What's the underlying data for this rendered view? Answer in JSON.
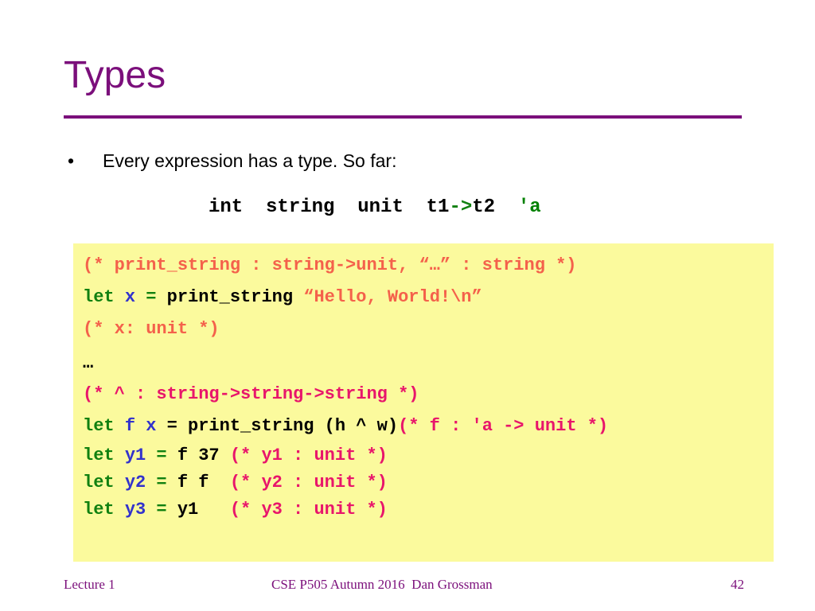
{
  "slide": {
    "title": "Types",
    "accent_color": "#7B0F7B",
    "bullet": {
      "marker": "•",
      "text": "Every expression has a type. So far:"
    },
    "typeline": {
      "segments": [
        {
          "text": "int  string  unit  t1",
          "color": "#000000"
        },
        {
          "text": "->",
          "color": "#108010"
        },
        {
          "text": "t2 ",
          "color": "#000000"
        },
        {
          "text": " ′a",
          "color": "#008000"
        }
      ]
    },
    "codebox": {
      "background": "#FBFA9D",
      "lines": [
        {
          "id": "comment-print-string",
          "segments": [
            {
              "text": "(* print_string : string->unit, “…” : string *)",
              "color": "#F4614B"
            }
          ]
        },
        {
          "id": "let-x",
          "segments": [
            {
              "text": "let",
              "color": "#108010"
            },
            {
              "text": " ",
              "color": "#000000"
            },
            {
              "text": "x",
              "color": "#3333CC"
            },
            {
              "text": " ",
              "color": "#000000"
            },
            {
              "text": "=",
              "color": "#108010"
            },
            {
              "text": " print_string ",
              "color": "#000000"
            },
            {
              "text": "“Hello, World!\\n”",
              "color": "#F4614B"
            }
          ]
        },
        {
          "id": "comment-x-unit",
          "segments": [
            {
              "text": "(* x: unit *)",
              "color": "#F4614B"
            }
          ]
        },
        {
          "id": "ellipsis",
          "segments": [
            {
              "text": "…",
              "color": "#000000"
            }
          ]
        },
        {
          "id": "comment-caret",
          "segments": [
            {
              "text": "(* ^ : string->string->string *)",
              "color": "#E8156B"
            }
          ]
        },
        {
          "id": "let-f-x",
          "segments": [
            {
              "text": "let",
              "color": "#108010"
            },
            {
              "text": " ",
              "color": "#000000"
            },
            {
              "text": "f x",
              "color": "#3333CC"
            },
            {
              "text": " = print_string (h ^ w)",
              "color": "#000000"
            },
            {
              "text": "(* f : ′a -> unit *)",
              "color": "#E8156B"
            }
          ]
        },
        {
          "id": "let-y1",
          "segments": [
            {
              "text": "let",
              "color": "#108010"
            },
            {
              "text": " ",
              "color": "#000000"
            },
            {
              "text": "y1",
              "color": "#3333CC"
            },
            {
              "text": " ",
              "color": "#000000"
            },
            {
              "text": "=",
              "color": "#108010"
            },
            {
              "text": " f 37 ",
              "color": "#000000"
            },
            {
              "text": "(* y1 : unit *)",
              "color": "#E8156B"
            }
          ]
        },
        {
          "id": "let-y2",
          "segments": [
            {
              "text": "let",
              "color": "#108010"
            },
            {
              "text": " ",
              "color": "#000000"
            },
            {
              "text": "y2",
              "color": "#3333CC"
            },
            {
              "text": " ",
              "color": "#000000"
            },
            {
              "text": "=",
              "color": "#108010"
            },
            {
              "text": " f f  ",
              "color": "#000000"
            },
            {
              "text": "(* y2 : unit *)",
              "color": "#E8156B"
            }
          ]
        },
        {
          "id": "let-y3",
          "segments": [
            {
              "text": "let",
              "color": "#108010"
            },
            {
              "text": " ",
              "color": "#000000"
            },
            {
              "text": "y3",
              "color": "#3333CC"
            },
            {
              "text": " ",
              "color": "#000000"
            },
            {
              "text": "=",
              "color": "#108010"
            },
            {
              "text": " y1   ",
              "color": "#000000"
            },
            {
              "text": "(* y3 : unit *)",
              "color": "#E8156B"
            }
          ]
        }
      ]
    },
    "footer": {
      "left": "Lecture 1",
      "center": "CSE P505 Autumn 2016  Dan Grossman",
      "right": "42"
    }
  }
}
